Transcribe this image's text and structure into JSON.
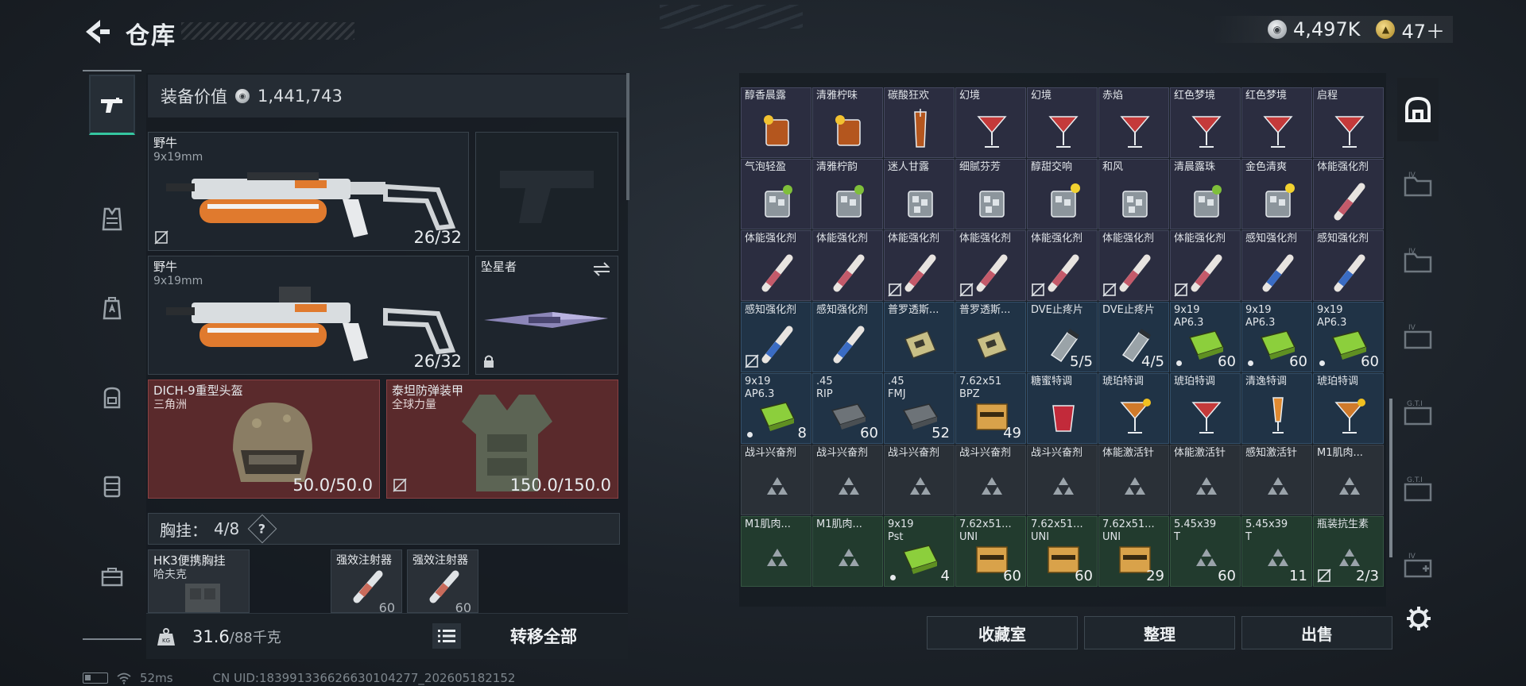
{
  "header": {
    "title": "仓库",
    "currency_silver": "4,497K",
    "currency_gold": "47＋"
  },
  "left_nav": {
    "tabs": [
      "weapons",
      "armor",
      "helmet",
      "backpack",
      "rig",
      "toolbox"
    ],
    "active": "weapons"
  },
  "equipment": {
    "value_label": "装备价值",
    "value": "1,441,743",
    "primary_weapon_1": {
      "name": "野牛",
      "caliber": "9x19mm",
      "ammo": "26/32"
    },
    "primary_weapon_2": {
      "name": "野牛",
      "caliber": "9x19mm",
      "ammo": "26/32"
    },
    "melee": {
      "name": "坠星者"
    },
    "helmet": {
      "name": "DICH-9重型头盔",
      "brand": "三角洲",
      "durability": "50.0/50.0"
    },
    "armor": {
      "name": "泰坦防弹装甲",
      "brand": "全球力量",
      "durability": "150.0/150.0"
    },
    "chest_rig": {
      "label": "胸挂：",
      "capacity": "4/8",
      "help": "?"
    },
    "rig_item": {
      "name": "HK3便携胸挂",
      "brand": "哈夫克"
    },
    "rig_slots": [
      {
        "name": "强效注射器",
        "count": "60"
      },
      {
        "name": "强效注射器",
        "count": "60"
      }
    ],
    "weight_current": "31.6",
    "weight_max": "/88千克",
    "transfer_all": "转移全部"
  },
  "storage": {
    "items": [
      {
        "label": "醇香晨露",
        "tone": "purple",
        "icon": "rocks-glass-citrus"
      },
      {
        "label": "清雅柠味",
        "tone": "purple",
        "icon": "rocks-glass-citrus"
      },
      {
        "label": "碳酸狂欢",
        "tone": "purple",
        "icon": "tall-glass-amber"
      },
      {
        "label": "幻境",
        "tone": "purple",
        "icon": "martini-red"
      },
      {
        "label": "幻境",
        "tone": "purple",
        "icon": "martini-red"
      },
      {
        "label": "赤焰",
        "tone": "purple",
        "icon": "martini-red"
      },
      {
        "label": "红色梦境",
        "tone": "purple",
        "icon": "martini-red"
      },
      {
        "label": "红色梦境",
        "tone": "purple",
        "icon": "martini-red"
      },
      {
        "label": "启程",
        "tone": "purple",
        "icon": "martini-red"
      },
      {
        "label": "气泡轻盈",
        "tone": "purple",
        "icon": "ice-glass-lime"
      },
      {
        "label": "清雅柠韵",
        "tone": "purple",
        "icon": "ice-glass-lime"
      },
      {
        "label": "迷人甘露",
        "tone": "purple",
        "icon": "ice-glass"
      },
      {
        "label": "细腻芬芳",
        "tone": "purple",
        "icon": "ice-glass"
      },
      {
        "label": "醇甜交响",
        "tone": "purple",
        "icon": "ice-glass-lemon"
      },
      {
        "label": "和风",
        "tone": "purple",
        "icon": "ice-glass"
      },
      {
        "label": "清晨露珠",
        "tone": "purple",
        "icon": "ice-glass-lime"
      },
      {
        "label": "金色清爽",
        "tone": "purple",
        "icon": "ice-glass-lemon"
      },
      {
        "label": "体能强化剂",
        "tone": "purple",
        "icon": "injector-red"
      },
      {
        "label": "体能强化剂",
        "tone": "purple",
        "icon": "injector-red"
      },
      {
        "label": "体能强化剂",
        "tone": "purple",
        "icon": "injector-red"
      },
      {
        "label": "体能强化剂",
        "tone": "purple",
        "icon": "injector-red",
        "locked": true
      },
      {
        "label": "体能强化剂",
        "tone": "purple",
        "icon": "injector-red",
        "locked": true
      },
      {
        "label": "体能强化剂",
        "tone": "purple",
        "icon": "injector-red",
        "locked": true
      },
      {
        "label": "体能强化剂",
        "tone": "purple",
        "icon": "injector-red",
        "locked": true
      },
      {
        "label": "体能强化剂",
        "tone": "purple",
        "icon": "injector-red",
        "locked": true
      },
      {
        "label": "感知强化剂",
        "tone": "purple",
        "icon": "injector-blue"
      },
      {
        "label": "感知强化剂",
        "tone": "purple",
        "icon": "injector-blue"
      },
      {
        "label": "感知强化剂",
        "tone": "blue",
        "icon": "injector-blue",
        "locked": true
      },
      {
        "label": "感知强化剂",
        "tone": "blue",
        "icon": "injector-blue"
      },
      {
        "label": "普罗透斯...",
        "tone": "blue",
        "icon": "medkit-pack"
      },
      {
        "label": "普罗透斯...",
        "tone": "blue",
        "icon": "medkit-pack"
      },
      {
        "label": "DVE止疼片",
        "tone": "blue",
        "icon": "pill-bottle",
        "count": "5/5"
      },
      {
        "label": "DVE止疼片",
        "tone": "blue",
        "icon": "pill-bottle",
        "count": "4/5"
      },
      {
        "label": "9x19\nAP6.3",
        "tone": "blue",
        "icon": "ammo-box-green",
        "count": "60",
        "dot": true
      },
      {
        "label": "9x19\nAP6.3",
        "tone": "blue",
        "icon": "ammo-box-green",
        "count": "60",
        "dot": true
      },
      {
        "label": "9x19\nAP6.3",
        "tone": "blue",
        "icon": "ammo-box-green",
        "count": "60",
        "dot": true
      },
      {
        "label": "9x19\nAP6.3",
        "tone": "blue",
        "icon": "ammo-box-green",
        "count": "8",
        "dot": true
      },
      {
        "label": ".45\nRIP",
        "tone": "blue",
        "icon": "ammo-box-gray",
        "count": "60"
      },
      {
        "label": ".45\nFMJ",
        "tone": "blue",
        "icon": "ammo-box-gray",
        "count": "52"
      },
      {
        "label": "7.62x51\nBPZ",
        "tone": "blue",
        "icon": "ammo-box-tan",
        "count": "49"
      },
      {
        "label": "糖蜜特调",
        "tone": "blue",
        "icon": "red-cup"
      },
      {
        "label": "琥珀特调",
        "tone": "blue",
        "icon": "martini-amber"
      },
      {
        "label": "琥珀特调",
        "tone": "blue",
        "icon": "martini-red"
      },
      {
        "label": "清逸特调",
        "tone": "blue",
        "icon": "flute-orange"
      },
      {
        "label": "琥珀特调",
        "tone": "blue",
        "icon": "martini-amber"
      },
      {
        "label": "战斗兴奋剂",
        "tone": "gray",
        "icon": "triforce"
      },
      {
        "label": "战斗兴奋剂",
        "tone": "gray",
        "icon": "triforce"
      },
      {
        "label": "战斗兴奋剂",
        "tone": "gray",
        "icon": "triforce"
      },
      {
        "label": "战斗兴奋剂",
        "tone": "gray",
        "icon": "triforce"
      },
      {
        "label": "战斗兴奋剂",
        "tone": "gray",
        "icon": "triforce"
      },
      {
        "label": "体能激活针",
        "tone": "gray",
        "icon": "triforce"
      },
      {
        "label": "体能激活针",
        "tone": "gray",
        "icon": "triforce"
      },
      {
        "label": "感知激活针",
        "tone": "gray",
        "icon": "triforce"
      },
      {
        "label": "M1肌肉...",
        "tone": "gray",
        "icon": "triforce"
      },
      {
        "label": "M1肌肉...",
        "tone": "green",
        "icon": "triforce"
      },
      {
        "label": "M1肌肉...",
        "tone": "green",
        "icon": "triforce"
      },
      {
        "label": "9x19\nPst",
        "tone": "green",
        "icon": "ammo-box-green",
        "count": "4",
        "dot": true
      },
      {
        "label": "7.62x51...\nUNI",
        "tone": "green",
        "icon": "ammo-box-tan",
        "count": "60"
      },
      {
        "label": "7.62x51...\nUNI",
        "tone": "green",
        "icon": "ammo-box-tan",
        "count": "60"
      },
      {
        "label": "7.62x51...\nUNI",
        "tone": "green",
        "icon": "ammo-box-tan",
        "count": "29"
      },
      {
        "label": "5.45x39\nT",
        "tone": "green",
        "icon": "triforce",
        "count": "60"
      },
      {
        "label": "5.45x39\nT",
        "tone": "green",
        "icon": "triforce",
        "count": "11"
      },
      {
        "label": "瓶装抗生素",
        "tone": "green",
        "icon": "triforce",
        "count": "2/3",
        "locked": true
      }
    ],
    "buttons": {
      "collection": "收藏室",
      "organize": "整理",
      "sell": "出售"
    }
  },
  "right_nav": {
    "tabs": [
      "house-icon",
      "folder-iv-icon",
      "folder-iv-icon",
      "case-iv-icon",
      "case-gti-icon",
      "case-gti-icon",
      "case-iv-plus-icon"
    ],
    "active": "house-icon"
  },
  "footer": {
    "ping": "52ms",
    "uid": "CN UID:183991336626630104277_202605182152"
  },
  "colors": {
    "accent": "#35c6a0",
    "rarity_purple": "#2b2d40",
    "rarity_blue": "#203346",
    "rarity_gray": "#2a3037",
    "rarity_green": "#223b2e",
    "rarity_red": "#5a2a2c"
  }
}
